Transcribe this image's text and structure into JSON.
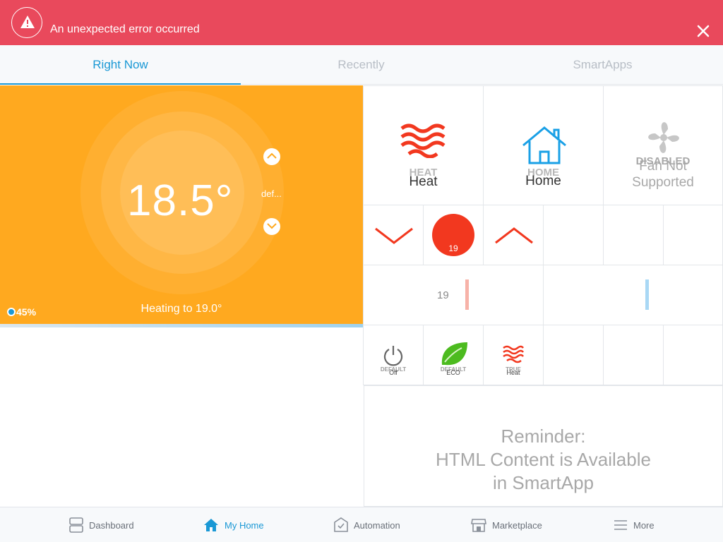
{
  "banner": {
    "message": "An unexpected error occurred",
    "icon": "warning-icon",
    "close_icon": "close-icon",
    "color": "#e9495c"
  },
  "tabs": [
    {
      "label": "Right Now",
      "active": true
    },
    {
      "label": "Recently",
      "active": false
    },
    {
      "label": "SmartApps",
      "active": false
    }
  ],
  "thermostat": {
    "temperature": "18.5°",
    "status": "Heating to 19.0°",
    "mode_label": "def...",
    "humidity": "45%",
    "color": "#ffa91f"
  },
  "tiles": {
    "heat": {
      "top": "HEAT",
      "label": "Heat",
      "icon": "heat-waves-icon"
    },
    "home": {
      "top": "HOME",
      "label": "Home",
      "icon": "house-icon"
    },
    "fan": {
      "top": "DISABLED",
      "label_line1": "Fan Not",
      "label_line2": "Supported",
      "icon": "fan-icon"
    },
    "setpoint_value": "19",
    "setpoint_slider_value": "19",
    "off": {
      "top": "DEFAULT",
      "label": "Off",
      "icon": "power-icon"
    },
    "eco": {
      "top": "DEFAULT",
      "label": "ECO",
      "icon": "leaf-icon"
    },
    "heat_small": {
      "top": "TRUE",
      "label": "Heat",
      "icon": "heat-waves-icon"
    }
  },
  "reminder": {
    "line1": "Reminder:",
    "line2": "HTML Content is Available",
    "line3": "in SmartApp"
  },
  "nav": [
    {
      "label": "Dashboard",
      "icon": "dashboard-icon",
      "active": false
    },
    {
      "label": "My Home",
      "icon": "home-icon",
      "active": true
    },
    {
      "label": "Automation",
      "icon": "automation-icon",
      "active": false
    },
    {
      "label": "Marketplace",
      "icon": "marketplace-icon",
      "active": false
    },
    {
      "label": "More",
      "icon": "menu-icon",
      "active": false
    }
  ]
}
